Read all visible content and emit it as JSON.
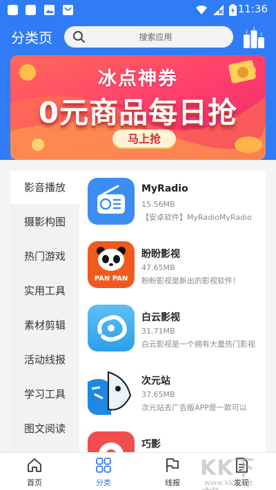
{
  "status_bar": {
    "time": "11:36"
  },
  "header": {
    "title": "分类页",
    "search_placeholder": "搜索应用"
  },
  "banner": {
    "subtitle": "冰点神券",
    "headline": "0元商品每日抢",
    "button_label": "马上抢"
  },
  "categories": [
    {
      "label": "影音播放",
      "active": true
    },
    {
      "label": "摄影构图"
    },
    {
      "label": "热门游戏"
    },
    {
      "label": "实用工具"
    },
    {
      "label": "素材剪辑"
    },
    {
      "label": "活动线报"
    },
    {
      "label": "学习工具"
    },
    {
      "label": "图文阅读"
    }
  ],
  "apps": [
    {
      "name": "MyRadio",
      "size": "15.56MB",
      "desc": "【安卓软件】MyRadioMyRadio",
      "icon": "radio-icon"
    },
    {
      "name": "盼盼影视",
      "size": "47.65MB",
      "desc": "盼盼影视是新出的影视软件！",
      "icon": "panda-icon"
    },
    {
      "name": "白云影视",
      "size": "31.71MB",
      "desc": "白云影视是一个拥有大量热门影视",
      "icon": "cloud-icon"
    },
    {
      "name": "次元站",
      "size": "37.65MB",
      "desc": "次元站去广告版APP是一款可以",
      "icon": "anime-icon"
    },
    {
      "name": "巧影",
      "size": "",
      "desc": "",
      "icon": "kinemaster-icon"
    }
  ],
  "bottom_nav": [
    {
      "label": "首页",
      "icon": "home-icon"
    },
    {
      "label": "分类",
      "icon": "grid-icon",
      "active": true
    },
    {
      "label": "线报",
      "icon": "flag-icon"
    },
    {
      "label": "发现",
      "icon": "document-icon"
    }
  ],
  "watermark": {
    "brand": "KK下载",
    "url": "www.kkx.net"
  },
  "colors": {
    "primary": "#2f7cf6",
    "banner_bg": "#ff4d6a"
  }
}
